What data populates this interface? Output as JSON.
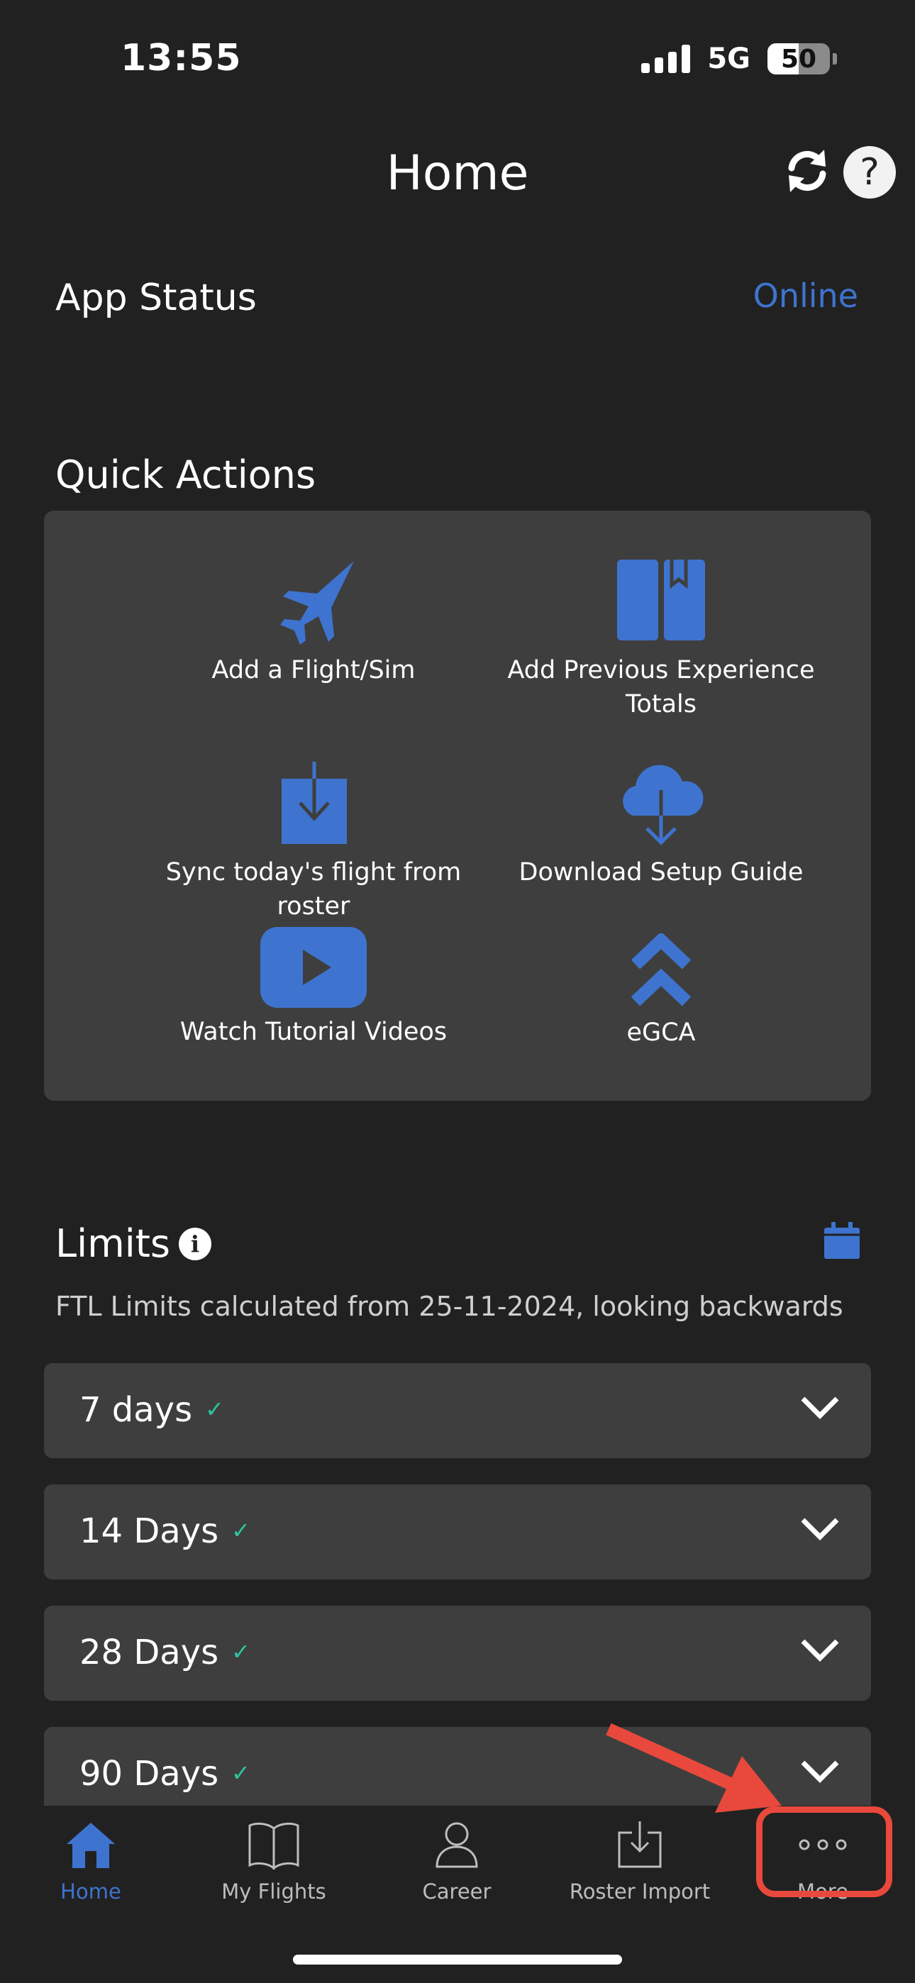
{
  "status_bar": {
    "time": "13:55",
    "network": "5G",
    "battery": "50"
  },
  "header": {
    "title": "Home",
    "sync_icon": "sync-icon",
    "help_icon": "help-icon",
    "help_glyph": "?"
  },
  "app_status": {
    "label": "App Status",
    "value": "Online"
  },
  "quick_actions": {
    "title": "Quick Actions",
    "items": [
      {
        "label": "Add a Flight/Sim",
        "icon": "jet-icon"
      },
      {
        "label": "Add Previous Experience Totals",
        "icon": "book-icon"
      },
      {
        "label": "Sync today's flight from roster",
        "icon": "download-box-icon"
      },
      {
        "label": "Download Setup Guide",
        "icon": "cloud-download-icon"
      },
      {
        "label": "Watch Tutorial Videos",
        "icon": "play-icon"
      },
      {
        "label": "eGCA",
        "icon": "egca-chevrons-icon"
      }
    ]
  },
  "limits": {
    "title": "Limits",
    "info_glyph": "i",
    "subtitle": "FTL Limits calculated from 25-11-2024, looking backwards",
    "rows": [
      {
        "label": "7 days",
        "check": "✓"
      },
      {
        "label": "14 Days",
        "check": "✓"
      },
      {
        "label": "28 Days",
        "check": "✓"
      },
      {
        "label": "90 Days",
        "check": "✓"
      }
    ]
  },
  "tabbar": {
    "tabs": [
      {
        "label": "Home",
        "icon": "home-icon",
        "active": true
      },
      {
        "label": "My Flights",
        "icon": "book-open-icon",
        "active": false
      },
      {
        "label": "Career",
        "icon": "person-icon",
        "active": false
      },
      {
        "label": "Roster Import",
        "icon": "import-icon",
        "active": false
      },
      {
        "label": "More",
        "icon": "more-dots-icon",
        "active": false
      }
    ]
  },
  "colors": {
    "accent": "#3e74cf",
    "background": "#212121",
    "card": "#3e3e3e",
    "check": "#2ec4a0",
    "annotation": "#e8493c"
  }
}
